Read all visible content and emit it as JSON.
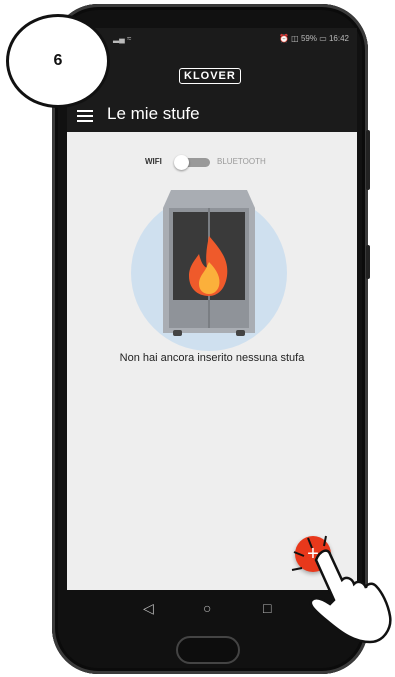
{
  "step": {
    "number": "6"
  },
  "status_bar": {
    "left_icons": "signal-wifi-icon",
    "right_text": "⏰ ◫ 59% ▭ 16:42"
  },
  "app": {
    "logo": "KLOVER",
    "title": "Le mie stufe",
    "toggle": {
      "left_label": "WIFI",
      "right_label": "BLUETOOTH",
      "state": "wifi"
    },
    "empty_message": "Non hai ancora inserito nessuna stufa",
    "fab_label": "+"
  },
  "nav": {
    "back": "◁",
    "home": "○",
    "recent": "□"
  },
  "colors": {
    "accent": "#e8381b",
    "appbar": "#1b1b1b",
    "background": "#eeeeee"
  }
}
